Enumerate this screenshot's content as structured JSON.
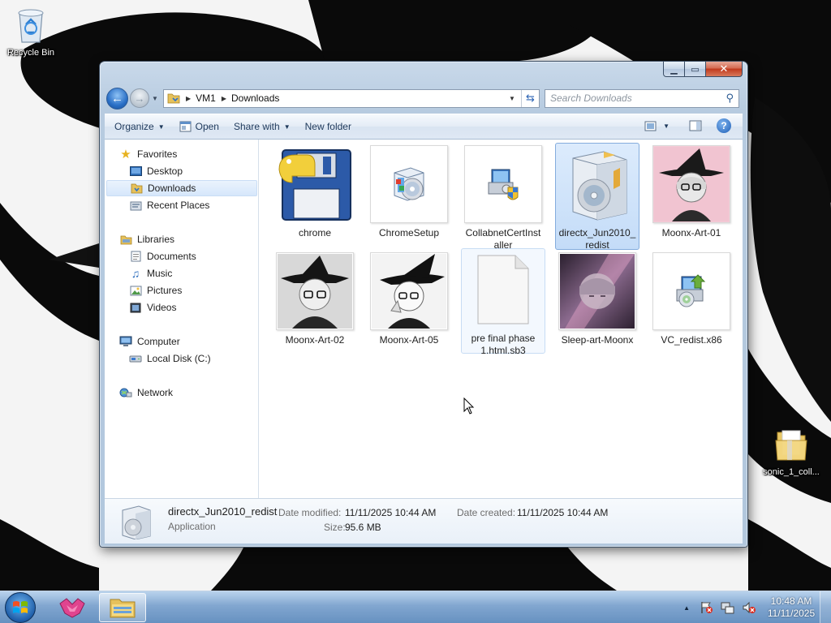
{
  "desktop": {
    "icons": [
      {
        "label": "Recycle Bin",
        "icon": "recycle-bin-icon"
      },
      {
        "label": "sonic_1_coll...",
        "icon": "folder-icon"
      }
    ]
  },
  "window": {
    "caption_buttons": {
      "minimize": "minimize-icon",
      "maximize": "maximize-icon",
      "close": "close-icon"
    },
    "address": {
      "crumbs": [
        "VM1",
        "Downloads"
      ]
    },
    "search": {
      "placeholder": "Search Downloads"
    },
    "commands": {
      "organize": "Organize",
      "open": "Open",
      "share_with": "Share with",
      "new_folder": "New folder"
    },
    "nav_pane": {
      "groups": [
        {
          "label": "Favorites",
          "icon": "star-icon",
          "items": [
            {
              "label": "Desktop",
              "icon": "desktop-icon"
            },
            {
              "label": "Downloads",
              "icon": "downloads-folder-icon",
              "selected": true
            },
            {
              "label": "Recent Places",
              "icon": "recent-places-icon"
            }
          ]
        },
        {
          "label": "Libraries",
          "icon": "libraries-icon",
          "items": [
            {
              "label": "Documents",
              "icon": "documents-icon"
            },
            {
              "label": "Music",
              "icon": "music-icon"
            },
            {
              "label": "Pictures",
              "icon": "pictures-icon"
            },
            {
              "label": "Videos",
              "icon": "videos-icon"
            }
          ]
        },
        {
          "label": "Computer",
          "icon": "computer-icon",
          "items": [
            {
              "label": "Local Disk (C:)",
              "icon": "disk-icon"
            }
          ]
        },
        {
          "label": "Network",
          "icon": "network-icon",
          "items": []
        }
      ]
    },
    "files": [
      {
        "name": "chrome",
        "icon": "python-floppy-icon"
      },
      {
        "name": "ChromeSetup",
        "icon": "installer-icon"
      },
      {
        "name": "CollabnetCertInstaller",
        "icon": "uac-installer-icon"
      },
      {
        "name": "directx_Jun2010_redist",
        "icon": "software-box-icon",
        "selected": true
      },
      {
        "name": "Moonx-Art-01",
        "icon": "art-thumbnail"
      },
      {
        "name": "Moonx-Art-02",
        "icon": "art-thumbnail"
      },
      {
        "name": "Moonx-Art-05",
        "icon": "art-thumbnail"
      },
      {
        "name": "pre final phase 1.html.sb3",
        "icon": "blank-file-icon",
        "hovered": true
      },
      {
        "name": "Sleep-art-Moonx",
        "icon": "art-thumbnail"
      },
      {
        "name": "VC_redist.x86",
        "icon": "setup-icon"
      }
    ],
    "details": {
      "name": "directx_Jun2010_redist",
      "type": "Application",
      "date_modified_label": "Date modified:",
      "date_modified": "11/11/2025 10:44 AM",
      "date_created_label": "Date created:",
      "date_created": "11/11/2025 10:44 AM",
      "size_label": "Size:",
      "size": "95.6 MB"
    }
  },
  "taskbar": {
    "clock_time": "10:48 AM",
    "clock_date": "11/11/2025"
  },
  "colors": {
    "selection": "#c4dcf8",
    "taskbar": "#6f96c4",
    "link": "#1e395b"
  }
}
